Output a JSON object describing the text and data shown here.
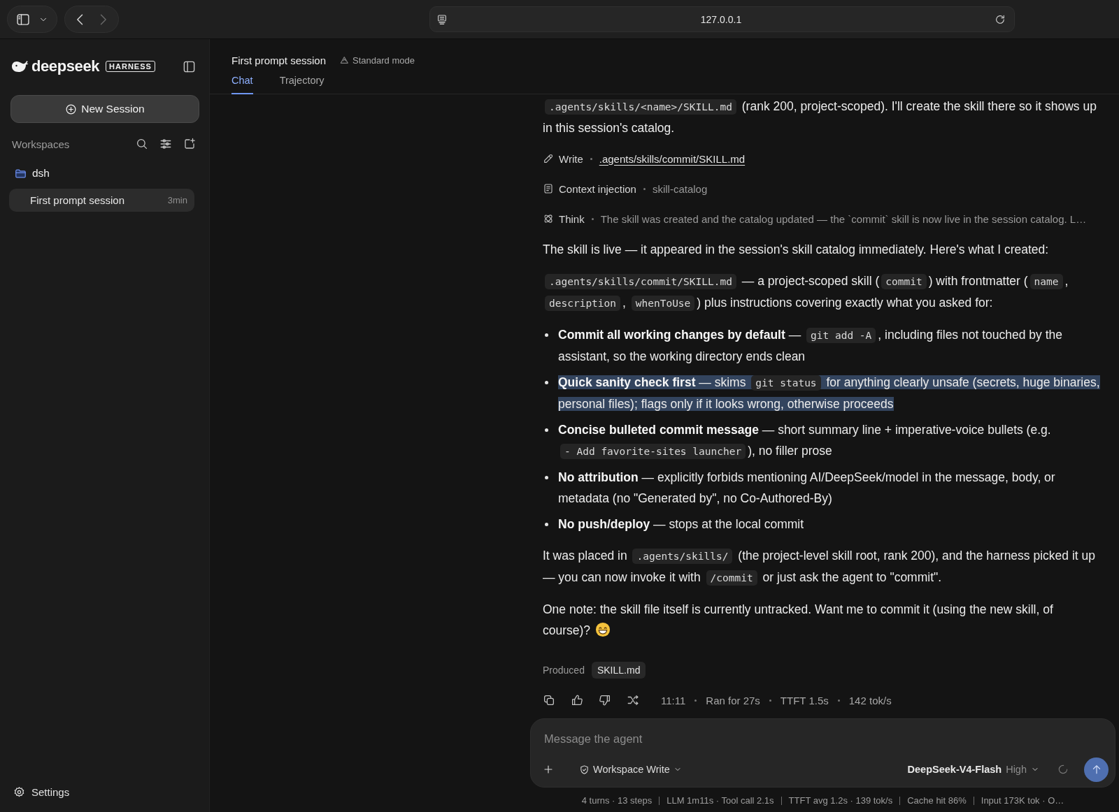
{
  "browser": {
    "address": "127.0.0.1"
  },
  "sidebar": {
    "logo": {
      "name": "deepseek",
      "badge": "HARNESS"
    },
    "new_session": "New Session",
    "workspaces_label": "Workspaces",
    "workspaces": [
      {
        "name": "dsh",
        "sessions": [
          {
            "title": "First prompt session",
            "age": "3min",
            "selected": true
          }
        ]
      }
    ],
    "settings": "Settings"
  },
  "header": {
    "title": "First prompt session",
    "mode": "Standard mode",
    "tabs": [
      {
        "label": "Chat",
        "selected": true
      },
      {
        "label": "Trajectory",
        "selected": false
      }
    ]
  },
  "message": {
    "blocks": [
      {
        "kind": "paragraph",
        "segments": [
          {
            "kind": "code",
            "text": ".agents/skills/<name>/SKILL.md"
          },
          {
            "kind": "text",
            "text": " (rank 200, project-scoped). I'll create the skill there so it shows up in this session's catalog."
          }
        ]
      },
      {
        "kind": "write",
        "label": "Write",
        "detail": ".agents/skills/commit/SKILL.md"
      },
      {
        "kind": "context",
        "label": "Context injection",
        "detail": "skill-catalog"
      },
      {
        "kind": "think",
        "label": "Think",
        "detail": "The skill was created and the catalog updated — the `commit` skill is now live in the session catalog. L…"
      },
      {
        "kind": "paragraph",
        "segments": [
          {
            "kind": "text",
            "text": "The skill is live — it appeared in the session's skill catalog immediately. Here's what I created:"
          }
        ]
      },
      {
        "kind": "paragraph",
        "segments": [
          {
            "kind": "code",
            "text": ".agents/skills/commit/SKILL.md"
          },
          {
            "kind": "text",
            "text": " — a project-scoped skill ("
          },
          {
            "kind": "code",
            "text": "commit"
          },
          {
            "kind": "text",
            "text": ") with frontmatter ("
          },
          {
            "kind": "code",
            "text": "name"
          },
          {
            "kind": "text",
            "text": ", "
          },
          {
            "kind": "code",
            "text": "description"
          },
          {
            "kind": "text",
            "text": ", "
          },
          {
            "kind": "code",
            "text": "whenToUse"
          },
          {
            "kind": "text",
            "text": ") plus instructions covering exactly what you asked for:"
          }
        ]
      },
      {
        "kind": "list",
        "items": [
          {
            "highlighted": false,
            "segments": [
              {
                "kind": "bold",
                "text": "Commit all working changes by default"
              },
              {
                "kind": "text",
                "text": " — "
              },
              {
                "kind": "code",
                "text": "git add -A"
              },
              {
                "kind": "text",
                "text": ", including files not touched by the assistant, so the working directory ends clean"
              }
            ]
          },
          {
            "highlighted": true,
            "segments": [
              {
                "kind": "bold",
                "text": "Quick sanity check first"
              },
              {
                "kind": "text",
                "text": " — skims "
              },
              {
                "kind": "code",
                "text": "git status"
              },
              {
                "kind": "text",
                "text": " for anything clearly unsafe (secrets, huge binaries, personal files); flags only if it looks wrong, otherwise proceeds"
              }
            ]
          },
          {
            "highlighted": false,
            "segments": [
              {
                "kind": "bold",
                "text": "Concise bulleted commit message"
              },
              {
                "kind": "text",
                "text": " — short summary line + imperative-voice bullets (e.g. "
              },
              {
                "kind": "code",
                "text": "- Add favorite-sites launcher"
              },
              {
                "kind": "text",
                "text": "), no filler prose"
              }
            ]
          },
          {
            "highlighted": false,
            "segments": [
              {
                "kind": "bold",
                "text": "No attribution"
              },
              {
                "kind": "text",
                "text": " — explicitly forbids mentioning AI/DeepSeek/model in the message, body, or metadata (no \"Generated by\", no Co-Authored-By)"
              }
            ]
          },
          {
            "highlighted": false,
            "segments": [
              {
                "kind": "bold",
                "text": "No push/deploy"
              },
              {
                "kind": "text",
                "text": " — stops at the local commit"
              }
            ]
          }
        ]
      },
      {
        "kind": "paragraph",
        "segments": [
          {
            "kind": "text",
            "text": "It was placed in "
          },
          {
            "kind": "code",
            "text": ".agents/skills/"
          },
          {
            "kind": "text",
            "text": " (the project-level skill root, rank 200), and the harness picked it up — you can now invoke it with "
          },
          {
            "kind": "code",
            "text": "/commit"
          },
          {
            "kind": "text",
            "text": " or just ask the agent to \"commit\"."
          }
        ]
      },
      {
        "kind": "paragraph",
        "segments": [
          {
            "kind": "text",
            "text": "One note: the skill file itself is currently untracked. Want me to commit it (using the new skill, of course)?"
          },
          {
            "kind": "emoji"
          }
        ]
      },
      {
        "kind": "produced",
        "label": "Produced",
        "files": [
          "SKILL.md"
        ]
      },
      {
        "kind": "actions",
        "meta": [
          "11:11",
          "Ran for 27s",
          "TTFT 1.5s",
          "142 tok/s"
        ]
      }
    ]
  },
  "composer": {
    "placeholder": "Message the agent",
    "permission": "Workspace Write",
    "model": "DeepSeek-V4-Flash",
    "effort": "High"
  },
  "status_bar": [
    "4 turns · 13 steps",
    "LLM 1m11s · Tool call 2.1s",
    "TTFT avg 1.2s · 139 tok/s",
    "Cache hit 86%",
    "Input 173K tok · O…"
  ]
}
